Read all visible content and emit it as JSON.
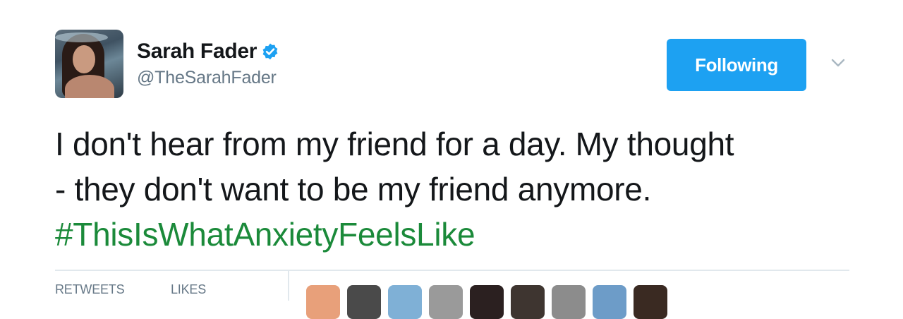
{
  "tweet": {
    "author": {
      "display_name": "Sarah Fader",
      "handle": "@TheSarahFader",
      "verified_icon": "verified-badge-icon",
      "avatar_icon": "profile-photo"
    },
    "follow_button_label": "Following",
    "menu_icon": "chevron-down-icon",
    "text_lines": [
      "I don't hear from my friend for a day. My thought",
      "- they don't want to be my friend anymore."
    ],
    "hashtag": "#ThisIsWhatAnxietyFeelsLike",
    "stats": {
      "retweets_label": "RETWEETS",
      "likes_label": "LIKES"
    },
    "liker_avatars": [
      {
        "color": "#e8a07a"
      },
      {
        "color": "#4a4a4a"
      },
      {
        "color": "#7fb0d6"
      },
      {
        "color": "#9a9a9a"
      },
      {
        "color": "#2b2020"
      },
      {
        "color": "#3e3530"
      },
      {
        "color": "#8c8c8c"
      },
      {
        "color": "#6d9cc8"
      },
      {
        "color": "#3a2a22"
      }
    ]
  },
  "colors": {
    "accent": "#1da1f2",
    "hashtag": "#1b8a3a",
    "secondary_text": "#657786",
    "divider": "#e1e8ed"
  }
}
